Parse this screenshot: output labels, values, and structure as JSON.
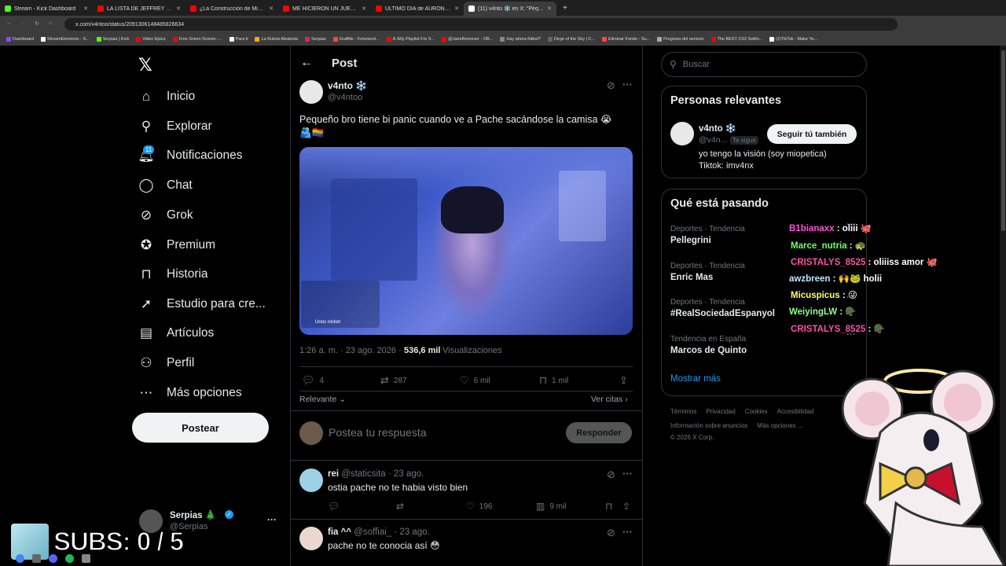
{
  "browser": {
    "tabs": [
      {
        "label": "Stream - Kick Dashboard",
        "color": "#53fc18",
        "active": false
      },
      {
        "label": "LA LISTA DE JEFFREY EPSTEIN Y",
        "color": "#ff0000",
        "active": false
      },
      {
        "label": "¿La Construcción de Minecraft e",
        "color": "#ff0000",
        "active": false
      },
      {
        "label": "ME HICIERON UN JUEGO DE",
        "color": "#ff0000",
        "active": false
      },
      {
        "label": "ULTIMO DIA de AURON con AG",
        "color": "#ff0000",
        "active": false
      },
      {
        "label": "(11) v4nto ❄️ en X: \"Peque",
        "color": "#ffffff",
        "active": true
      }
    ],
    "new_tab": "+",
    "url": "x.com/v4ntoo/status/2091306148485826634",
    "bookmarks": [
      {
        "label": "Dashboard",
        "color": "#9146ff"
      },
      {
        "label": "StreamElements - S...",
        "color": "#ffffff"
      },
      {
        "label": "Serpias | Kick",
        "color": "#53fc18"
      },
      {
        "label": "Video Epico",
        "color": "#ff0000"
      },
      {
        "label": "Free Green Screen -...",
        "color": "#ff0000"
      },
      {
        "label": "Para ti",
        "color": "#ffffff"
      },
      {
        "label": "La Ruleta Aleatoria",
        "color": "#ffaa00"
      },
      {
        "label": "Serpias",
        "color": "#e91e63"
      },
      {
        "label": "GrafMe - Fotomont...",
        "color": "#ff4444"
      },
      {
        "label": "A Silly Playlist For S...",
        "color": "#ff0000"
      },
      {
        "label": "@JaneRemover - OB...",
        "color": "#ff0000"
      },
      {
        "label": "Hay ahora fútbol?",
        "color": "#888888"
      },
      {
        "label": "Dirge of the Sky | C...",
        "color": "#666666"
      },
      {
        "label": "Eliminar Fondo - Su...",
        "color": "#ff4444"
      },
      {
        "label": "Progreso del servicio",
        "color": "#aaaaaa"
      },
      {
        "label": "The BEST CS2 Settin...",
        "color": "#ff0000"
      },
      {
        "label": "(2)TikTok - Make Yo...",
        "color": "#ffffff"
      }
    ]
  },
  "nav": {
    "logo": "𝕏",
    "items": [
      {
        "label": "Inicio",
        "icon": "home-icon",
        "glyph": "⌂"
      },
      {
        "label": "Explorar",
        "icon": "search-icon",
        "glyph": "⚲"
      },
      {
        "label": "Notificaciones",
        "icon": "bell-icon",
        "glyph": "🔔︎"
      },
      {
        "label": "Chat",
        "icon": "chat-icon",
        "glyph": "◯"
      },
      {
        "label": "Grok",
        "icon": "grok-icon",
        "glyph": "⊘"
      },
      {
        "label": "Premium",
        "icon": "premium-icon",
        "glyph": "✪"
      },
      {
        "label": "Historia",
        "icon": "bookmark-icon",
        "glyph": "⊓"
      },
      {
        "label": "Estudio para cre...",
        "icon": "rocket-icon",
        "glyph": "➚"
      },
      {
        "label": "Artículos",
        "icon": "article-icon",
        "glyph": "▤"
      },
      {
        "label": "Perfil",
        "icon": "profile-icon",
        "glyph": "⚇"
      },
      {
        "label": "Más opciones",
        "icon": "more-icon",
        "glyph": "⋯"
      }
    ],
    "notif_count": "11",
    "post_button": "Postear",
    "account": {
      "name": "Serpias 🎄",
      "handle": "@Serpias",
      "more": "···"
    }
  },
  "post": {
    "header": "Post",
    "author_name": "v4nto ❄️",
    "author_handle": "@v4ntoo",
    "text_line1": "Pequeño bro tiene bi panic cuando ve a Pache sacándose la camisa 😭",
    "text_line2": "🫂🏳️‍🌈",
    "timestamp": "1:26 a. m. · 23 ago. 2026 ·",
    "views_count": "536,6 mil",
    "views_label": "Visualizaciones",
    "replies": "4",
    "reposts": "287",
    "likes": "6 mil",
    "bookmarks": "1 mil",
    "sort_label": "Relevante",
    "quotes_label": "Ver citas",
    "reply_placeholder": "Postea tu respuesta",
    "reply_button": "Responder",
    "video_overlay": "Unos rocket"
  },
  "replies": [
    {
      "name": "rei",
      "handle": "@staticsita",
      "date": "· 23 ago.",
      "text": "ostia pache no te habia visto bien",
      "likes": "196",
      "views": "9 mil"
    },
    {
      "name": "fia ^^",
      "handle": "@soffiai_",
      "date": "· 23 ago.",
      "text": "pache no te conocia así 😳"
    }
  ],
  "sidebar": {
    "search_placeholder": "Buscar",
    "relevant_title": "Personas relevantes",
    "relevant_name": "v4nto ❄️",
    "relevant_handle": "@v4n...",
    "follows_you": "Te sigue",
    "follow_button": "Seguir tú también",
    "bio_line1": "yo tengo la visión (soy miopetica)",
    "bio_line2": "Tiktok: imv4nx",
    "trends_title": "Qué está pasando",
    "trends": [
      {
        "category": "Deportes · Tendencia",
        "name": "Pellegrini"
      },
      {
        "category": "Deportes · Tendencia",
        "name": "Enric Mas"
      },
      {
        "category": "Deportes · Tendencia",
        "name": "#RealSociedadEspanyol"
      },
      {
        "category": "Tendencia en España",
        "name": "Marcos de Quinto"
      }
    ],
    "show_more": "Mostrar más",
    "footer_line1": [
      "Términos",
      "Privacidad",
      "Cookies",
      "Accesibilidad"
    ],
    "footer_line2": [
      "Información sobre anuncios",
      "Más opciones ..."
    ],
    "copyright": "© 2026 X Corp."
  },
  "stream_chat": [
    {
      "user": "B1bianaxx",
      "msg": ": oliii 🐙",
      "color": "#ff4fd8"
    },
    {
      "user": "Marce_nutria",
      "msg": ": 🐢",
      "color": "#6bff6b"
    },
    {
      "user": "CRISTALYS_8525",
      "msg": ": oliiiss amor 🐙",
      "color": "#ff4fa8"
    },
    {
      "user": "awzbreen",
      "msg": ":  🙌🐸  holii",
      "color": "#bfe6ff"
    },
    {
      "user": "Micuspicus",
      "msg": ": 😜",
      "color": "#ffff66"
    },
    {
      "user": "WeiyingLW",
      "msg": ": 🪖",
      "color": "#8cff8c"
    },
    {
      "user": "CRISTALYS_8525",
      "msg": ": 🪖",
      "color": "#ff4fa8"
    }
  ],
  "overlay": {
    "subs": "SUBS: 0 / 5"
  }
}
